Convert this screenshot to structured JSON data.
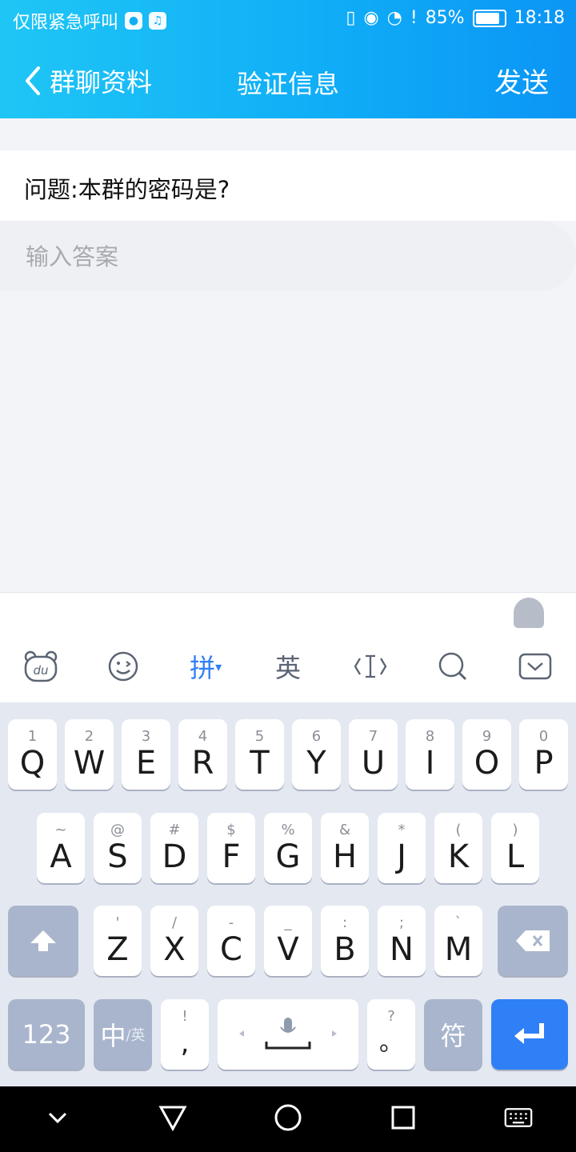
{
  "status_bar": {
    "carrier": "仅限紧急呼叫",
    "battery": "85%",
    "battery_level": 0.85,
    "time": "18:18",
    "icons": [
      "app-badge-icon",
      "music-icon",
      "vibrate-icon",
      "eye-icon",
      "wifi-icon",
      "alert-icon",
      "battery-icon"
    ]
  },
  "nav": {
    "back_label": "群聊资料",
    "title": "验证信息",
    "send_label": "发送"
  },
  "content": {
    "question": "问题:本群的密码是?",
    "answer_placeholder": "输入答案"
  },
  "keyboard": {
    "toolbar": [
      {
        "name": "du-icon",
        "label": "du"
      },
      {
        "name": "emoji-icon",
        "label": ""
      },
      {
        "name": "pinyin-mode",
        "label": "拼"
      },
      {
        "name": "english-mode",
        "label": "英"
      },
      {
        "name": "cursor-icon",
        "label": ""
      },
      {
        "name": "search-icon",
        "label": ""
      },
      {
        "name": "collapse-keyboard-icon",
        "label": ""
      }
    ],
    "row1": [
      {
        "sub": "1",
        "main": "Q"
      },
      {
        "sub": "2",
        "main": "W"
      },
      {
        "sub": "3",
        "main": "E"
      },
      {
        "sub": "4",
        "main": "R"
      },
      {
        "sub": "5",
        "main": "T"
      },
      {
        "sub": "6",
        "main": "Y"
      },
      {
        "sub": "7",
        "main": "U"
      },
      {
        "sub": "8",
        "main": "I"
      },
      {
        "sub": "9",
        "main": "O"
      },
      {
        "sub": "0",
        "main": "P"
      }
    ],
    "row2": [
      {
        "sub": "~",
        "main": "A"
      },
      {
        "sub": "@",
        "main": "S"
      },
      {
        "sub": "#",
        "main": "D"
      },
      {
        "sub": "$",
        "main": "F"
      },
      {
        "sub": "%",
        "main": "G"
      },
      {
        "sub": "&",
        "main": "H"
      },
      {
        "sub": "*",
        "main": "J"
      },
      {
        "sub": "(",
        "main": "K"
      },
      {
        "sub": ")",
        "main": "L"
      }
    ],
    "row3": [
      {
        "sub": "'",
        "main": "Z"
      },
      {
        "sub": "/",
        "main": "X"
      },
      {
        "sub": "-",
        "main": "C"
      },
      {
        "sub": "_",
        "main": "V"
      },
      {
        "sub": ":",
        "main": "B"
      },
      {
        "sub": ";",
        "main": "N"
      },
      {
        "sub": "`",
        "main": "M"
      }
    ],
    "bottom": {
      "num_label": "123",
      "lang_label": "中",
      "lang_sub": "/英",
      "comma_sub": "!",
      "comma_main": ",",
      "period_sub": "?",
      "period_main": "。",
      "symbol_label": "符"
    }
  },
  "colors": {
    "header_start": "#1fc6f5",
    "header_end": "#0b95f5",
    "accent": "#2f7ff7",
    "keyboard_bg": "#e4e8f1"
  }
}
